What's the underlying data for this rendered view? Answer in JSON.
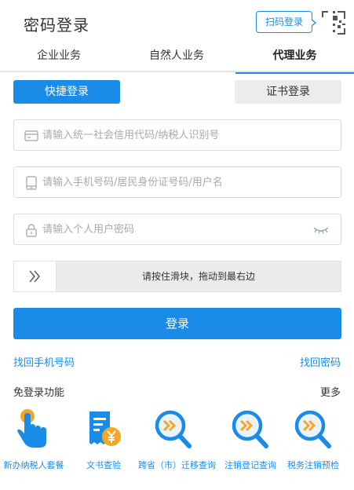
{
  "header": {
    "title": "密码登录",
    "scan_login": "扫码登录",
    "qr_icon": "qr-code-icon"
  },
  "tabs": [
    {
      "label": "企业业务",
      "active": false
    },
    {
      "label": "自然人业务",
      "active": false
    },
    {
      "label": "代理业务",
      "active": true
    }
  ],
  "login_modes": {
    "quick": "快捷登录",
    "cert": "证书登录"
  },
  "fields": {
    "credit_code": {
      "placeholder": "请输入统一社会信用代码/纳税人识别号",
      "value": "",
      "icon": "card-icon"
    },
    "phone": {
      "placeholder": "请输入手机号码/居民身份证号码/用户名",
      "value": "",
      "icon": "phone-icon"
    },
    "password": {
      "placeholder": "请输入个人用户密码",
      "value": "",
      "icon": "lock-icon",
      "toggle_icon": "eye-closed-icon"
    }
  },
  "slider": {
    "text": "请按住滑块，拖动到最右边",
    "icon": "double-chevron-right-icon"
  },
  "login_button": "登录",
  "links": {
    "recover_phone": "找回手机号码",
    "recover_password": "找回密码"
  },
  "free_login": {
    "title": "免登录功能",
    "more": "更多",
    "items": [
      {
        "label": "新办纳税人套餐",
        "icon": "hand-tap-icon"
      },
      {
        "label": "文书查验",
        "icon": "receipt-yuan-icon"
      },
      {
        "label": "跨省（市）迁移查询",
        "icon": "search-icon"
      },
      {
        "label": "注销登记查询",
        "icon": "search-icon"
      },
      {
        "label": "税务注销预检",
        "icon": "search-icon"
      }
    ]
  },
  "colors": {
    "accent": "#1a8ce8",
    "secondary_button": "#ececec",
    "icon_orange": "#f5a623"
  }
}
